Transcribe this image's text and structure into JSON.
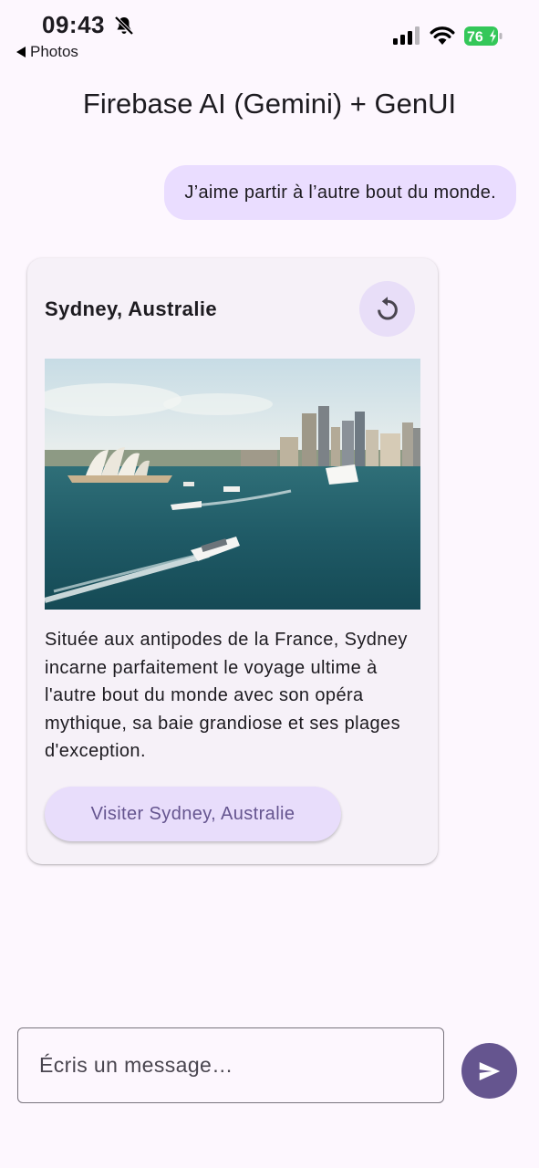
{
  "status_bar": {
    "time": "09:43",
    "back_label": "Photos",
    "battery_level": "76",
    "icons": [
      "bell-slash-icon",
      "cellular-signal-icon",
      "wifi-icon",
      "battery-charging-icon"
    ]
  },
  "app_bar": {
    "title": "Firebase AI (Gemini) + GenUI"
  },
  "chat": {
    "user_message": "J’aime partir à l’autre bout du monde.",
    "card": {
      "title": "Sydney, Australie",
      "refresh_icon": "refresh-icon",
      "description": "Située aux antipodes de la France, Sydney incarne parfaitement le voyage ultime à l'autre bout du monde avec son opéra mythique, sa baie grandiose et ses plages d'exception.",
      "button_label": "Visiter Sydney, Australie"
    }
  },
  "composer": {
    "placeholder": "Écris un message…",
    "send_icon": "send-icon"
  },
  "colors": {
    "background": "#fdf7fe",
    "user_bubble": "#eaddff",
    "card": "#f6f1f8",
    "accent": "#65558f",
    "battery": "#34c759"
  }
}
